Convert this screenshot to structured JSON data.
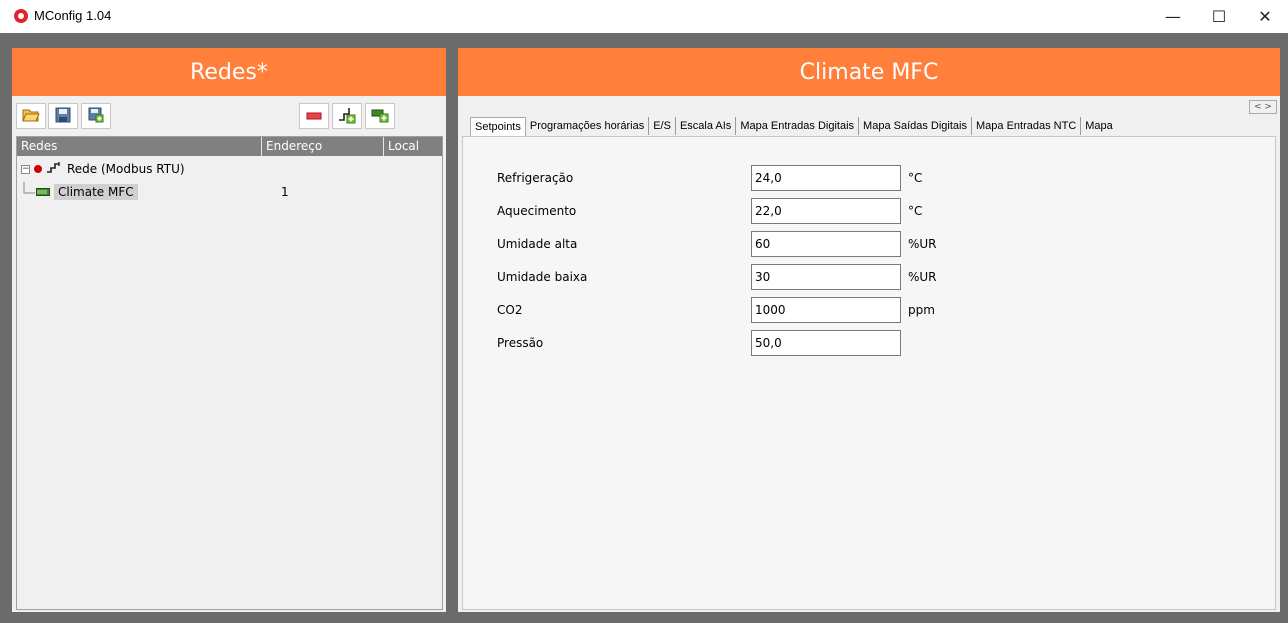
{
  "window": {
    "title": "MConfig 1.04",
    "min_glyph": "—",
    "max_glyph": "☐",
    "close_glyph": "✕"
  },
  "left_panel": {
    "title": "Redes*",
    "toolbar": [
      "open-folder-icon",
      "save-icon",
      "save-as-icon",
      "remove-icon",
      "add-network-icon",
      "add-device-icon"
    ],
    "columns": {
      "redes": "Redes",
      "endereco": "Endereço",
      "local": "Local"
    },
    "tree": {
      "network_label": "Rede  (Modbus RTU)",
      "device_label": "Climate MFC",
      "device_address": "1"
    }
  },
  "right_panel": {
    "title": "Climate MFC",
    "tabs": [
      "Setpoints",
      "Programações horárias",
      "E/S",
      "Escala AIs",
      "Mapa Entradas Digitais",
      "Mapa Saídas Digitais",
      "Mapa Entradas NTC",
      "Mapa"
    ],
    "tab_scroll": "< >",
    "fields": [
      {
        "label": "Refrigeração",
        "value": "24,0",
        "unit": "°C"
      },
      {
        "label": "Aquecimento",
        "value": "22,0",
        "unit": "°C"
      },
      {
        "label": "Umidade alta",
        "value": "60",
        "unit": "%UR"
      },
      {
        "label": "Umidade baixa",
        "value": "30",
        "unit": "%UR"
      },
      {
        "label": "CO2",
        "value": "1000",
        "unit": "ppm"
      },
      {
        "label": "Pressão",
        "value": "50,0",
        "unit": ""
      }
    ]
  },
  "colors": {
    "accent": "#ff7f3b",
    "frame": "#6b6b6b",
    "panel": "#f0f0f0",
    "status_dot": "#d00000"
  }
}
